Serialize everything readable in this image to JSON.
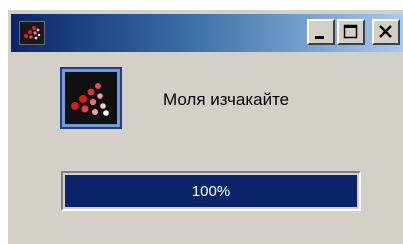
{
  "window": {
    "title": "",
    "message": "Моля изчакайте",
    "titlebar_gradient": [
      "#0a246a",
      "#a6caf0"
    ],
    "face_color": "#d4d0c8"
  },
  "titlebar_buttons": {
    "minimize": "minimize-icon",
    "maximize": "maximize-icon",
    "close": "close-icon"
  },
  "progress": {
    "label": "100%",
    "value_percent": 100,
    "fill_color": "#0a246a"
  },
  "icons": {
    "app": "dots-app-icon"
  }
}
